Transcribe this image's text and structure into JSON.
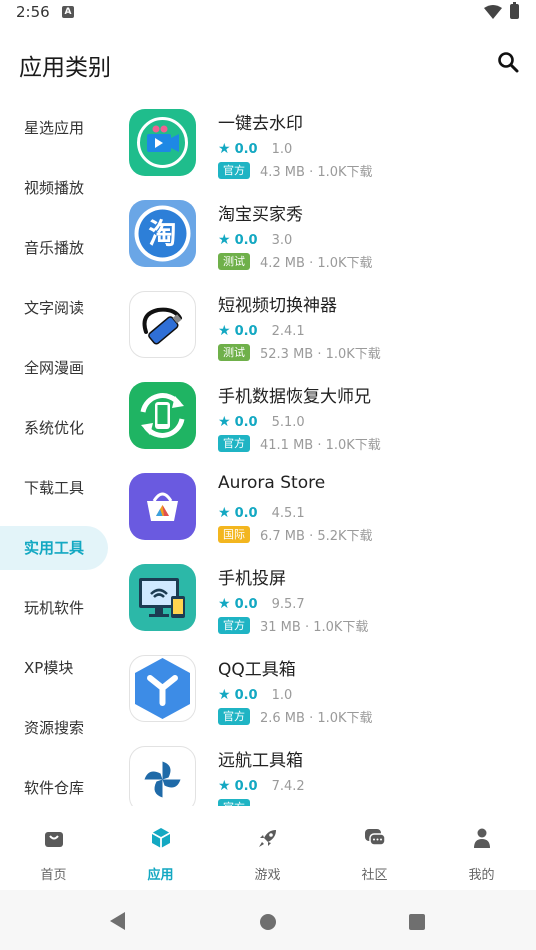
{
  "status": {
    "time": "2:56",
    "a_icon": "A"
  },
  "header": {
    "title": "应用类别"
  },
  "sidebar": {
    "items": [
      {
        "label": "星选应用",
        "active": false
      },
      {
        "label": "视频播放",
        "active": false
      },
      {
        "label": "音乐播放",
        "active": false
      },
      {
        "label": "文字阅读",
        "active": false
      },
      {
        "label": "全网漫画",
        "active": false
      },
      {
        "label": "系统优化",
        "active": false
      },
      {
        "label": "下载工具",
        "active": false
      },
      {
        "label": "实用工具",
        "active": true
      },
      {
        "label": "玩机软件",
        "active": false
      },
      {
        "label": "XP模块",
        "active": false
      },
      {
        "label": "资源搜索",
        "active": false
      },
      {
        "label": "软件仓库",
        "active": false
      }
    ]
  },
  "apps": [
    {
      "name": "一键去水印",
      "rating": "0.0",
      "version": "1.0",
      "tag": "官方",
      "tag_color": "#1fb4c4",
      "size": "4.3 MB · 1.0K下载",
      "icon": "video-watermark-icon"
    },
    {
      "name": "淘宝买家秀",
      "rating": "0.0",
      "version": "3.0",
      "tag": "测试",
      "tag_color": "#6fb04a",
      "size": "4.2 MB · 1.0K下载",
      "icon": "taobao-icon"
    },
    {
      "name": "短视频切换神器",
      "rating": "0.0",
      "version": "2.4.1",
      "tag": "测试",
      "tag_color": "#6fb04a",
      "size": "52.3 MB · 1.0K下载",
      "icon": "usb-plug-icon"
    },
    {
      "name": "手机数据恢复大师兄",
      "rating": "0.0",
      "version": "5.1.0",
      "tag": "官方",
      "tag_color": "#1fb4c4",
      "size": "41.1 MB · 1.0K下载",
      "icon": "phone-recovery-icon"
    },
    {
      "name": "Aurora Store",
      "rating": "0.0",
      "version": "4.5.1",
      "tag": "国际",
      "tag_color": "#f3b61f",
      "size": "6.7 MB · 5.2K下载",
      "icon": "aurora-store-icon"
    },
    {
      "name": "手机投屏",
      "rating": "0.0",
      "version": "9.5.7",
      "tag": "官方",
      "tag_color": "#1fb4c4",
      "size": "31 MB · 1.0K下载",
      "icon": "screen-cast-icon"
    },
    {
      "name": "QQ工具箱",
      "rating": "0.0",
      "version": "1.0",
      "tag": "官方",
      "tag_color": "#1fb4c4",
      "size": "2.6 MB · 1.0K下载",
      "icon": "qq-toolbox-icon"
    },
    {
      "name": "远航工具箱",
      "rating": "0.0",
      "version": "7.4.2",
      "tag": "官方",
      "tag_color": "#1fb4c4",
      "size": "",
      "icon": "pinwheel-icon"
    }
  ],
  "tabs": [
    {
      "label": "首页",
      "active": false,
      "icon": "bag-icon"
    },
    {
      "label": "应用",
      "active": true,
      "icon": "cube-icon"
    },
    {
      "label": "游戏",
      "active": false,
      "icon": "rocket-icon"
    },
    {
      "label": "社区",
      "active": false,
      "icon": "chat-icon"
    },
    {
      "label": "我的",
      "active": false,
      "icon": "person-icon"
    }
  ],
  "colors": {
    "accent": "#13a8c2",
    "official": "#1fb4c4",
    "test": "#6fb04a",
    "intl": "#f3b61f"
  }
}
